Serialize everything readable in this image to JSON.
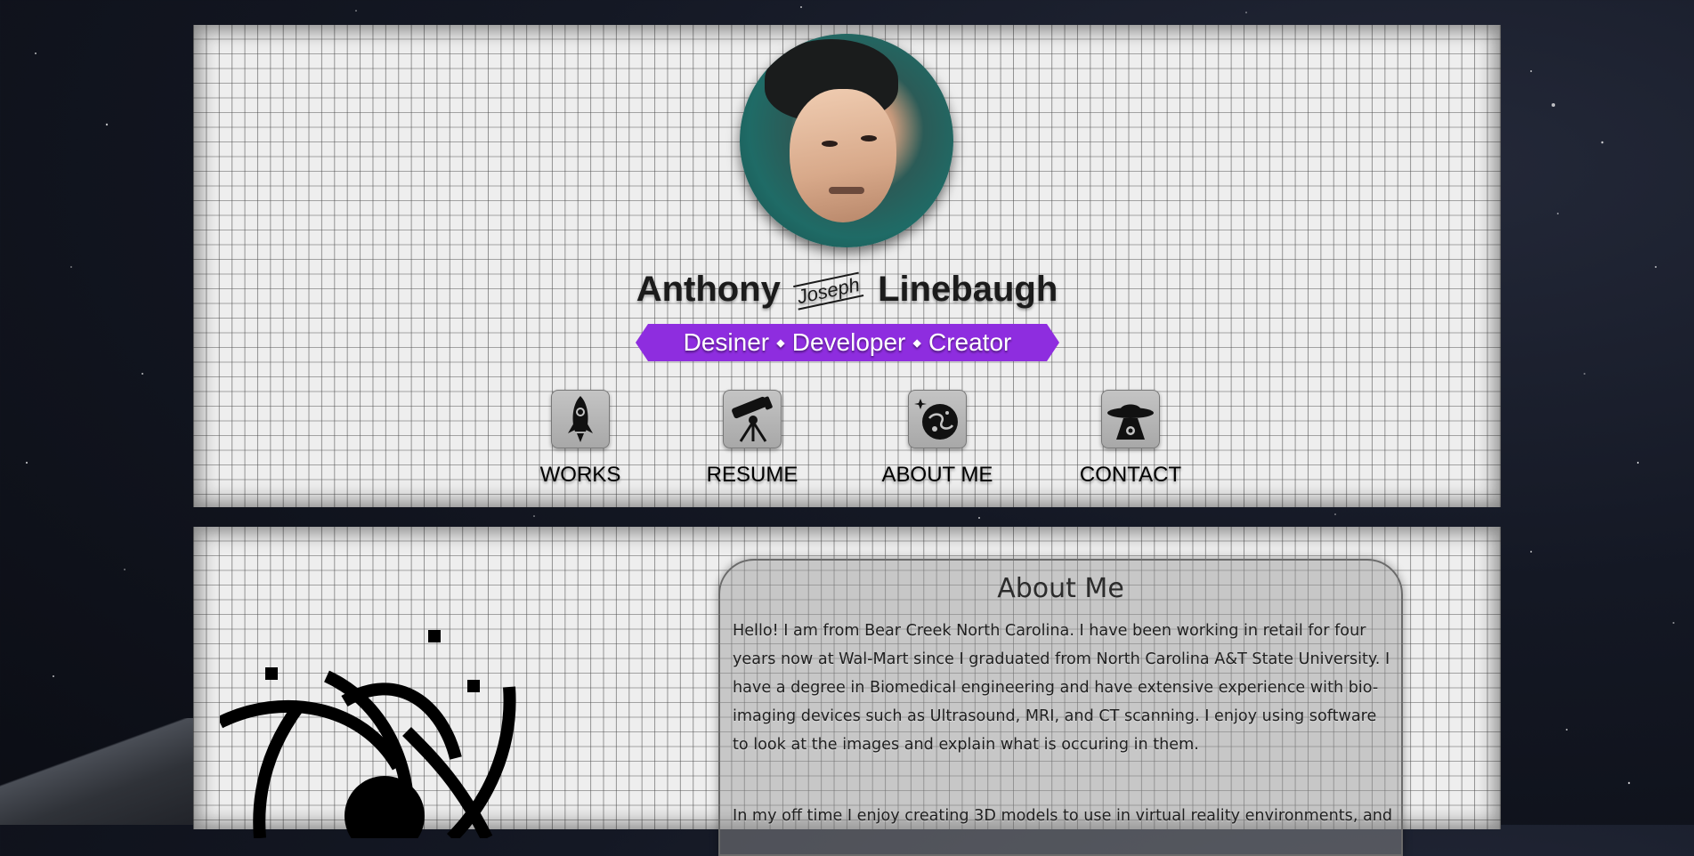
{
  "header": {
    "first_name": "Anthony",
    "middle_name": "Joseph",
    "last_name": "Linebaugh",
    "tagline": "Desiner ⬩ Developer ⬩ Creator",
    "tagline_color": "#8e2ddf"
  },
  "nav": [
    {
      "label": "WORKS",
      "icon": "rocket-icon"
    },
    {
      "label": "RESUME",
      "icon": "telescope-icon"
    },
    {
      "label": "ABOUT ME",
      "icon": "planet-icon"
    },
    {
      "label": "CONTACT",
      "icon": "ufo-icon"
    }
  ],
  "about": {
    "title": "About Me",
    "paragraphs": [
      "Hello! I am from Bear Creek North Carolina. I have been working in retail for four years now at Wal-Mart since I graduated from North Carolina A&T State University. I have a degree in Biomedical engineering and have extensive experience with bio-imaging devices such as Ultrasound, MRI, and CT scanning. I enjoy using software to look at the images and explain what is occuring in them.",
      "In my off time I enjoy creating 3D models to use in virtual reality environments, and"
    ]
  }
}
